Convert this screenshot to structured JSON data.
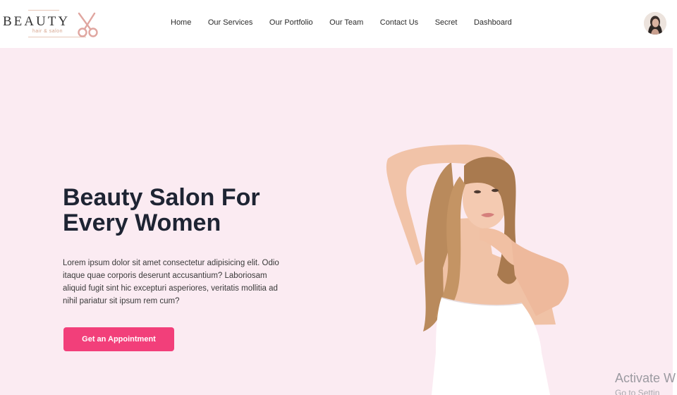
{
  "brand": {
    "name": "BEAUTY",
    "tagline": "hair & salon"
  },
  "nav": {
    "items": [
      {
        "label": "Home"
      },
      {
        "label": "Our Services"
      },
      {
        "label": "Our Portfolio"
      },
      {
        "label": "Our Team"
      },
      {
        "label": "Contact Us"
      },
      {
        "label": "Secret"
      },
      {
        "label": "Dashboard"
      }
    ]
  },
  "hero": {
    "title": "Beauty Salon For Every Women",
    "body": "Lorem ipsum dolor sit amet consectetur adipisicing elit. Odio itaque quae corporis deserunt accusantium? Laboriosam aliquid fugit sint hic excepturi asperiores, veritatis mollitia ad nihil pariatur sit ipsum rem cum?",
    "cta_label": "Get an Appointment"
  },
  "watermark": {
    "title": "Activate W",
    "subtitle": "Go to Settin"
  },
  "colors": {
    "accent": "#f23f7a",
    "hero_bg": "#fbebf2",
    "heading": "#1e2433",
    "logo_accent": "#d6a58e"
  },
  "icons": {
    "logo": "scissors-icon",
    "avatar": "user-avatar"
  }
}
